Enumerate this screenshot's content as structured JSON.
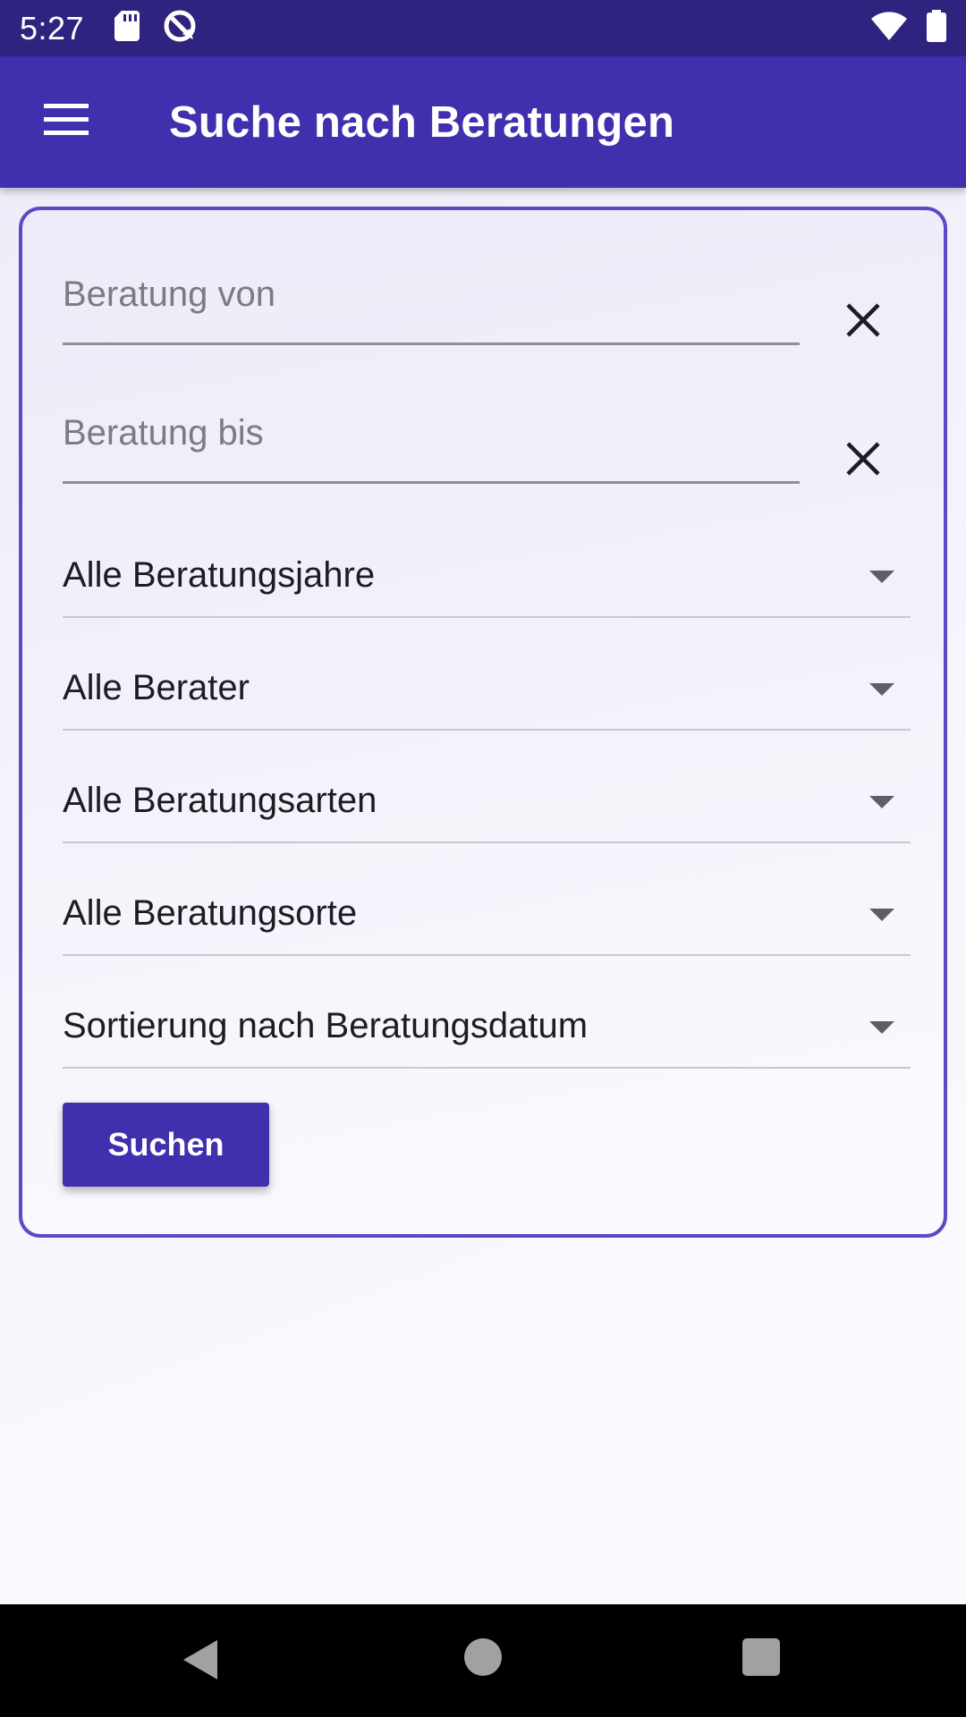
{
  "status_bar": {
    "time": "5:27",
    "icons": [
      "sd-card-icon",
      "sync-disabled-icon",
      "wifi-icon",
      "battery-icon"
    ]
  },
  "app_bar": {
    "title": "Suche nach Beratungen",
    "menu_icon": "menu-icon"
  },
  "form": {
    "date_from": {
      "placeholder": "Beratung von",
      "value": ""
    },
    "date_to": {
      "placeholder": "Beratung bis",
      "value": ""
    },
    "dropdowns": {
      "years": "Alle Beratungsjahre",
      "advisors": "Alle Berater",
      "types": "Alle Beratungsarten",
      "locations": "Alle Beratungsorte",
      "sort": "Sortierung nach Beratungsdatum"
    },
    "search_label": "Suchen"
  },
  "colors": {
    "status_bar": "#2f2380",
    "primary": "#4030ad",
    "card_border": "#5b4ac8"
  }
}
